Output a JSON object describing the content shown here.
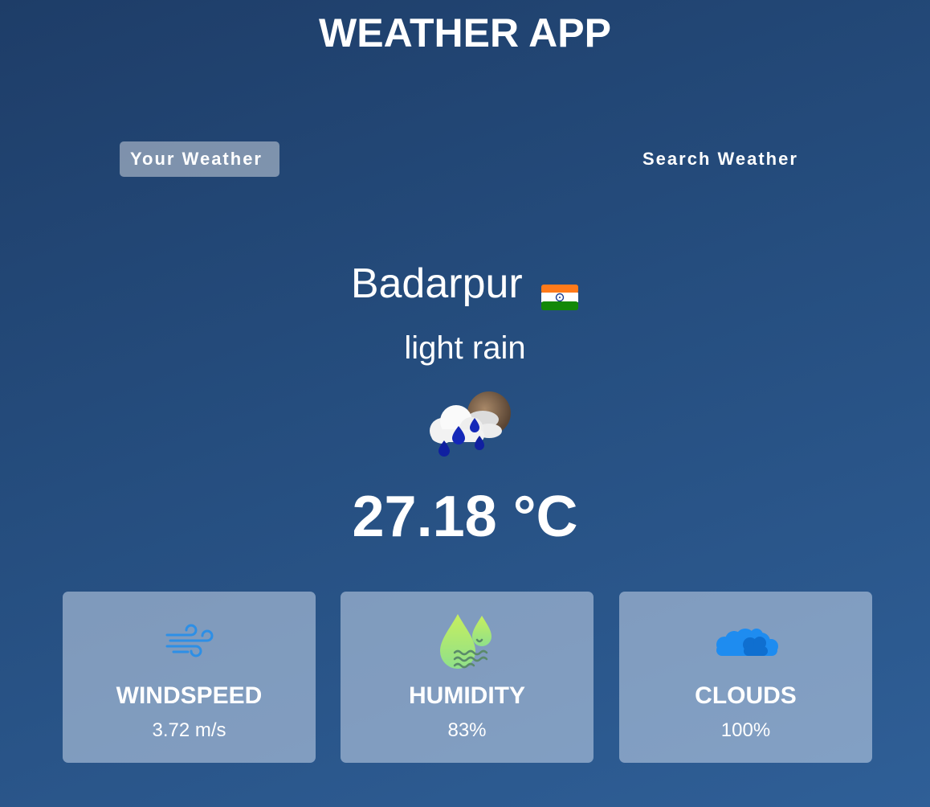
{
  "app": {
    "title": "WEATHER APP"
  },
  "tabs": [
    {
      "label": "Your Weather",
      "active": true
    },
    {
      "label": "Search Weather",
      "active": false
    }
  ],
  "location": {
    "city": "Badarpur",
    "country_flag_icon": "india-flag-icon"
  },
  "weather": {
    "description": "light rain",
    "icon": "rain-cloud-moon-icon",
    "temperature": "27.18 °C"
  },
  "stats": [
    {
      "label": "WINDSPEED",
      "value": "3.72 m/s",
      "icon": "wind-icon"
    },
    {
      "label": "HUMIDITY",
      "value": "83%",
      "icon": "humidity-drops-icon"
    },
    {
      "label": "CLOUDS",
      "value": "100%",
      "icon": "clouds-icon"
    }
  ],
  "colors": {
    "background_top": "#1e3d68",
    "background_bottom": "#2f5f97",
    "card_background": "#8aa2c2",
    "wind_icon": "#2d8fe6",
    "clouds_icon": "#1e8cf0"
  }
}
